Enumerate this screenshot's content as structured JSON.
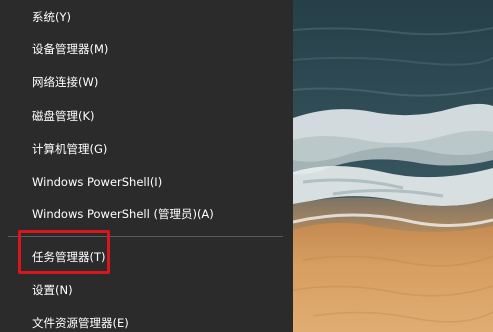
{
  "context_menu": {
    "items": [
      {
        "label": "系统(Y)"
      },
      {
        "label": "设备管理器(M)"
      },
      {
        "label": "网络连接(W)"
      },
      {
        "label": "磁盘管理(K)"
      },
      {
        "label": "计算机管理(G)"
      },
      {
        "label": "Windows PowerShell(I)"
      },
      {
        "label": "Windows PowerShell (管理员)(A)"
      },
      {
        "label": "任务管理器(T)"
      },
      {
        "label": "设置(N)"
      },
      {
        "label": "文件资源管理器(E)"
      }
    ],
    "highlighted_index": 7,
    "highlight_color": "#d7171d",
    "menu_background": "#2b2b2b",
    "text_color": "#ffffff"
  },
  "wallpaper": {
    "description_icon": "beach-wallpaper",
    "colors": {
      "sea": "#2d4a55",
      "foam": "#e9eef0",
      "sand": "#d49a5a"
    }
  }
}
